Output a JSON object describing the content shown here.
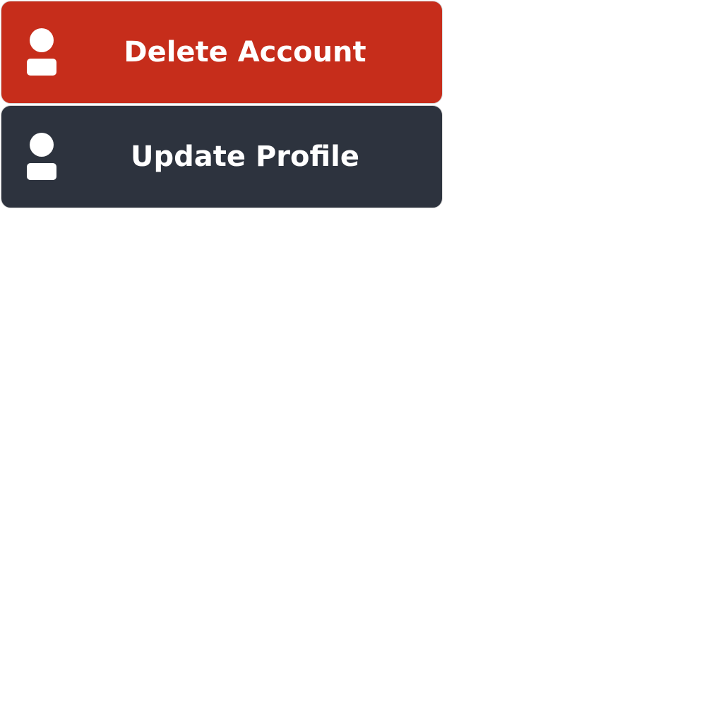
{
  "buttons": {
    "delete": {
      "label": "Delete Account",
      "color": "#c62d1b",
      "icon": "user-icon"
    },
    "update": {
      "label": "Update Profile",
      "color": "#2d333e",
      "icon": "user-icon"
    }
  }
}
